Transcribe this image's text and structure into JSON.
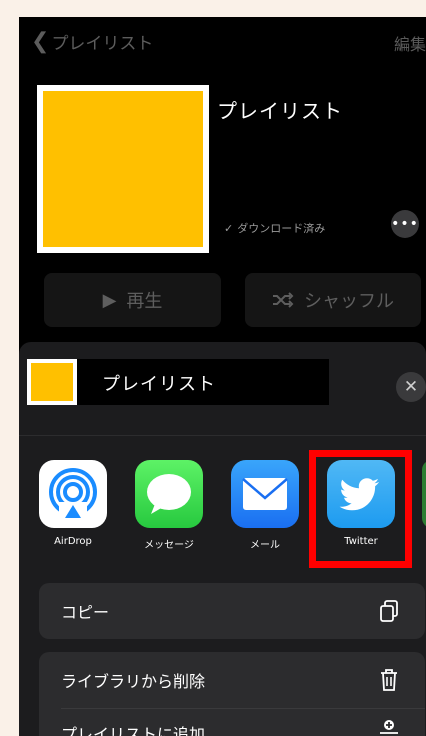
{
  "nav": {
    "back_label": "プレイリスト",
    "edit_label": "編集"
  },
  "header": {
    "title": "プレイリスト",
    "download_status": "ダウンロード済み",
    "more_label": "•••"
  },
  "buttons": {
    "play_label": "再生",
    "shuffle_label": "シャッフル"
  },
  "share_sheet": {
    "title": "プレイリスト",
    "close_label": "✕",
    "apps": [
      {
        "label": "AirDrop",
        "icon": "airdrop-icon"
      },
      {
        "label": "メッセージ",
        "icon": "messages-icon"
      },
      {
        "label": "メール",
        "icon": "mail-icon"
      },
      {
        "label": "Twitter",
        "icon": "twitter-icon"
      }
    ],
    "actions": [
      {
        "label": "コピー",
        "icon": "copy-icon"
      },
      {
        "label": "ライブラリから削除",
        "icon": "trash-icon"
      },
      {
        "label": "プレイリストに追加...",
        "icon": "add-to-playlist-icon"
      }
    ]
  },
  "colors": {
    "artwork": "#ffc000",
    "highlight": "#ff0000",
    "sheet_bg": "#1c1c1e"
  }
}
